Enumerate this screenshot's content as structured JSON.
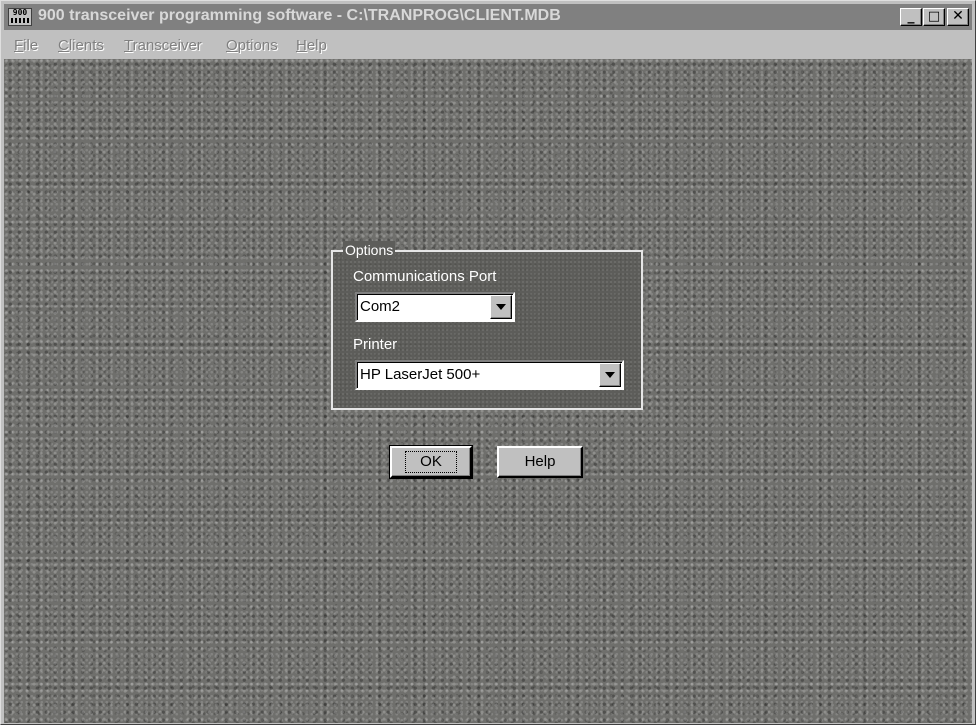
{
  "window": {
    "title": "900 transceiver programming software - C:\\TRANPROG\\CLIENT.MDB",
    "app_icon_text": "900",
    "controls": {
      "minimize": "_",
      "maximize": "□",
      "close": "✕"
    }
  },
  "menu": {
    "items": [
      "File",
      "Clients",
      "Transceiver",
      "Options",
      "Help"
    ]
  },
  "options": {
    "group_label": "Options",
    "comm_port": {
      "label": "Communications Port",
      "value": "Com2"
    },
    "printer": {
      "label": "Printer",
      "value": "HP LaserJet 500+"
    }
  },
  "buttons": {
    "ok": "OK",
    "help": "Help"
  },
  "colors": {
    "titlebar_inactive": "#808080",
    "desktop_texture": "#6f6f6c",
    "dialog_face": "#c0c0c0"
  }
}
